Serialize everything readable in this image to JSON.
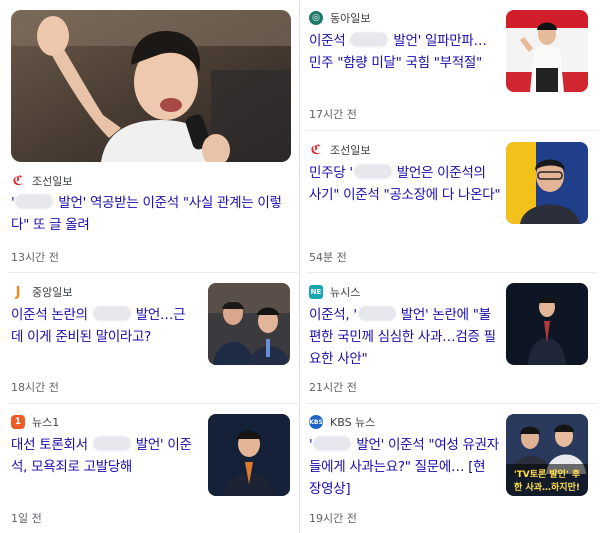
{
  "left_column": [
    {
      "source": "조선일보",
      "logo_icon": "chosun-logo-icon",
      "logo_color": "#d7262c",
      "title_parts": [
        "'",
        "MASK",
        " 발언' 역공받는 이준석 \"사실 관계는 이렇",
        "BR",
        "다\" 또 글 올려"
      ],
      "time": "13시간 전"
    },
    {
      "source": "중앙일보",
      "logo_icon": "joongang-logo-icon",
      "logo_color": "#f08a24",
      "title_parts": [
        "이준석 논란의 ",
        "MASK",
        " 발언…근",
        "BR",
        "데 이게 준비된 말이라고?"
      ],
      "time": "18시간 전"
    },
    {
      "source": "뉴스1",
      "logo_icon": "news1-logo-icon",
      "logo_color": "#f15a29",
      "title_parts": [
        "대선 토론회서 ",
        "MASK",
        " 발언' 이준",
        "BR",
        "석, 모욕죄로 고발당해"
      ],
      "time": "1일 전"
    }
  ],
  "right_column": [
    {
      "source": "동아일보",
      "logo_icon": "donga-logo-icon",
      "logo_color": "#1f7a6b",
      "title_parts": [
        "이준석 ",
        "MASK",
        " 발언' 일파만파…",
        "BR",
        "민주 \"함량 미달\" 국힘 \"부적절\""
      ],
      "time": "17시간 전"
    },
    {
      "source": "조선일보",
      "logo_icon": "chosun-logo-icon",
      "logo_color": "#d7262c",
      "title_parts": [
        "민주당 '",
        "MASK",
        " 발언은 이준석의",
        "BR",
        "사기\" 이준석 \"공소장에 다 나온다\""
      ],
      "time": "54분 전"
    },
    {
      "source": "뉴시스",
      "logo_icon": "newsis-logo-icon",
      "logo_color": "#19a6b3",
      "title_parts": [
        "이준석, '",
        "MASK",
        " 발언' 논란에 \"불",
        "BR",
        "편한 국민께 심심한 사과…검증 필",
        "BR",
        "요한 사안\""
      ],
      "time": "21시간 전"
    },
    {
      "source": "KBS 뉴스",
      "logo_icon": "kbs-logo-icon",
      "logo_color": "#1c64c8",
      "title_parts": [
        "'",
        "MASK",
        " 발언' 이준석 \"여성 유권자",
        "BR",
        "들에게 사과는요?\" 질문에… [현",
        "BR",
        "장영상]"
      ],
      "time": "19시간 전",
      "thumb_caption_1": "'TV토론 발언' 후",
      "thumb_caption_2": "한 사과…하지만!"
    }
  ]
}
